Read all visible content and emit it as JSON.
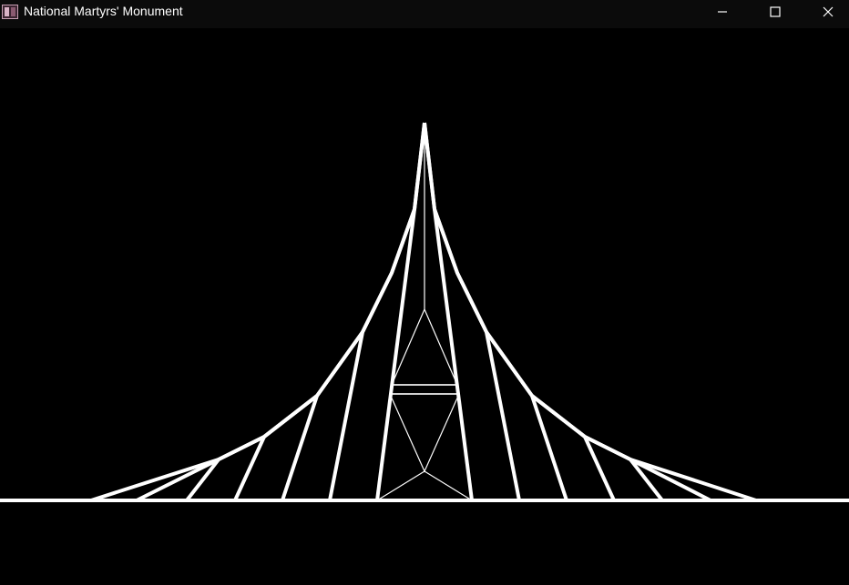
{
  "window": {
    "title": "National Martyrs' Monument",
    "icon": "app-window-icon",
    "controls": {
      "minimize": "minimize-icon",
      "maximize": "maximize-icon",
      "close": "close-icon"
    }
  },
  "colors": {
    "background": "#000000",
    "titlebar": "#0b0b0b",
    "stroke": "#ffffff"
  }
}
